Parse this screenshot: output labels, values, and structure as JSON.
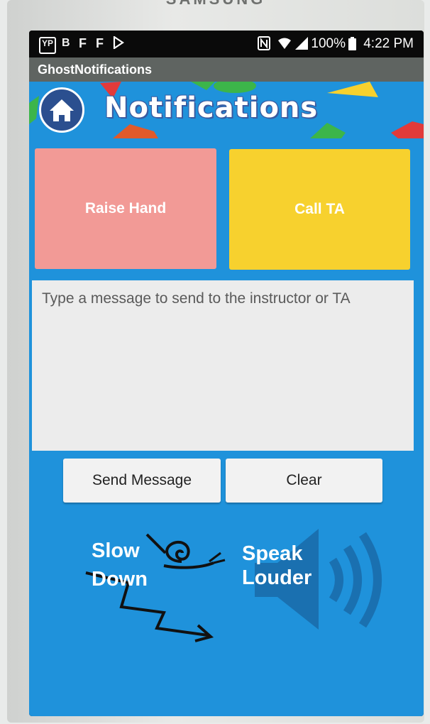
{
  "device": {
    "brand": "SAMSUNG"
  },
  "status_bar": {
    "left_icons": [
      "YP",
      "B",
      "F",
      "F",
      "play"
    ],
    "right_icons": [
      "nfc-icon",
      "wifi-icon",
      "signal-icon"
    ],
    "battery": "100%",
    "time": "4:22 PM"
  },
  "app": {
    "title": "GhostNotifications"
  },
  "header": {
    "title": "Notifications"
  },
  "buttons": {
    "raise_hand": "Raise Hand",
    "call_ta": "Call TA",
    "send_message": "Send Message",
    "clear": "Clear"
  },
  "message": {
    "placeholder": "Type a message to send to the instructor or TA",
    "value": ""
  },
  "gestures": {
    "slow_down_line1": "Slow",
    "slow_down_line2": "Down",
    "speak_louder_line1": "Speak",
    "speak_louder_line2": "Louder"
  },
  "colors": {
    "background": "#1f92db",
    "raise_hand": "#f29a96",
    "call_ta": "#f7d12e",
    "title_bar": "#5f6461"
  }
}
